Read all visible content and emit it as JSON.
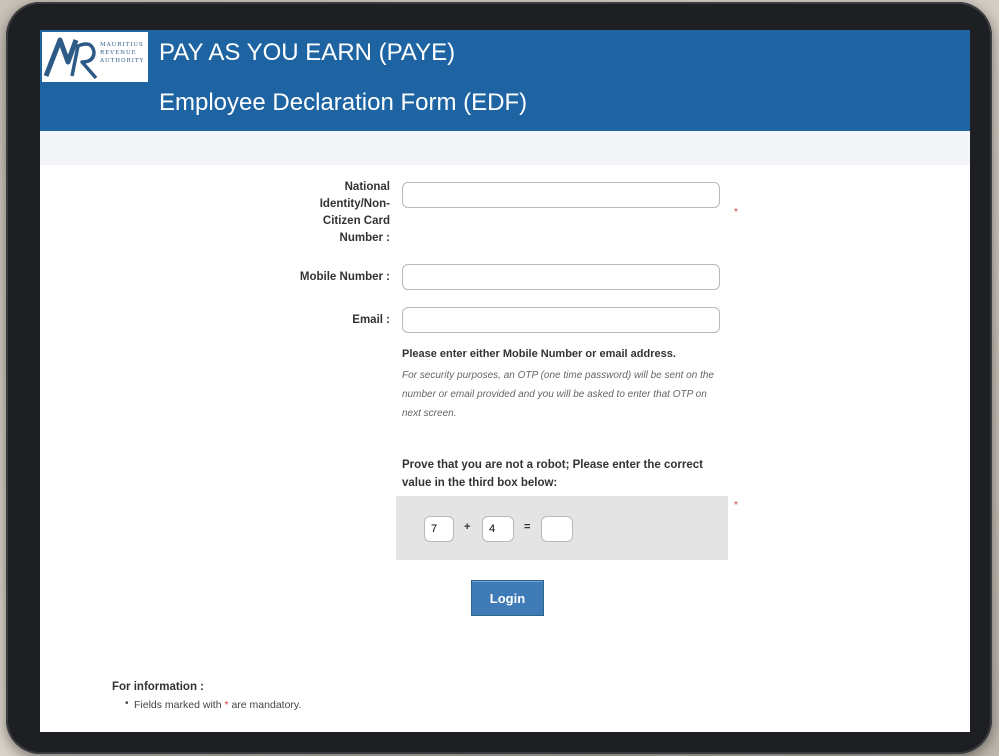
{
  "header": {
    "logo_text": "MAURITIUS REVENUE AUTHORITY",
    "title": "PAY AS YOU EARN (PAYE)",
    "subtitle": "Employee Declaration Form (EDF)"
  },
  "form": {
    "nic_label": "National Identity/Non-Citizen Card Number :",
    "nic_value": "",
    "mobile_label": "Mobile Number :",
    "mobile_value": "",
    "email_label": "Email :",
    "email_value": "",
    "required_marker": "*",
    "note_bold": "Please enter either Mobile Number or email address.",
    "note_italic": "For security purposes, an OTP (one time password) will be sent on the number or email provided and you will be asked to enter that OTP on next screen."
  },
  "captcha": {
    "instruction": "Prove that you are not a robot; Please enter the correct value in the third box below:",
    "first": "7",
    "operator": "+",
    "second": "4",
    "equals": "=",
    "answer": ""
  },
  "login_label": "Login",
  "info": {
    "title": "For information :",
    "item_prefix": "Fields marked with",
    "item_star": "*",
    "item_suffix": "are mandatory."
  },
  "colors": {
    "header_blue": "#1e64a3",
    "button_blue": "#3f7bb6",
    "required_red": "#d13b3b"
  }
}
